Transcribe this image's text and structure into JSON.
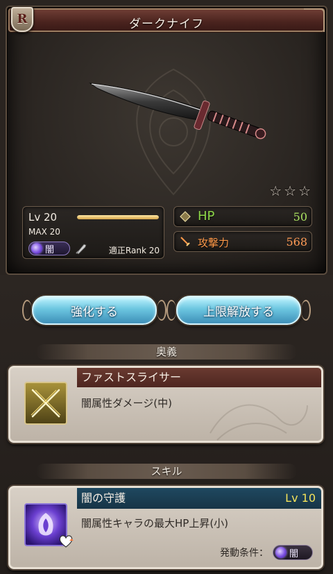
{
  "header": {
    "rarity": "R",
    "weapon_name": "ダークナイフ"
  },
  "rarity_stars": 3,
  "level": {
    "label": "Lv",
    "value": "20",
    "max_label": "MAX 20",
    "progress": 1.0,
    "element": "闇",
    "rank_label": "適正Rank 20"
  },
  "stats": {
    "hp_label": "HP",
    "hp_value": "50",
    "atk_label": "攻撃力",
    "atk_value": "568"
  },
  "buttons": {
    "enhance_label": "強化する",
    "uncap_label": "上限解放する"
  },
  "ougi": {
    "header": "奥義",
    "name": "ファストスライサー",
    "description": "闇属性ダメージ(中)",
    "icon": "crossed-swords-icon"
  },
  "skill": {
    "header": "スキル",
    "name": "闇の守護",
    "level": "Lv 10",
    "description": "闇属性キャラの最大HP上昇(小)",
    "condition_label": "発動条件：",
    "condition_element": "闇",
    "icon": "dark-guard-icon"
  },
  "colors": {
    "title_bar": "#4a231e",
    "hp_text": "#8fd84a",
    "atk_text": "#ff9a4a",
    "button_blue": "#6cc6e0",
    "dark_element": "#7a4ee0",
    "skill_level": "#f4e35a"
  }
}
